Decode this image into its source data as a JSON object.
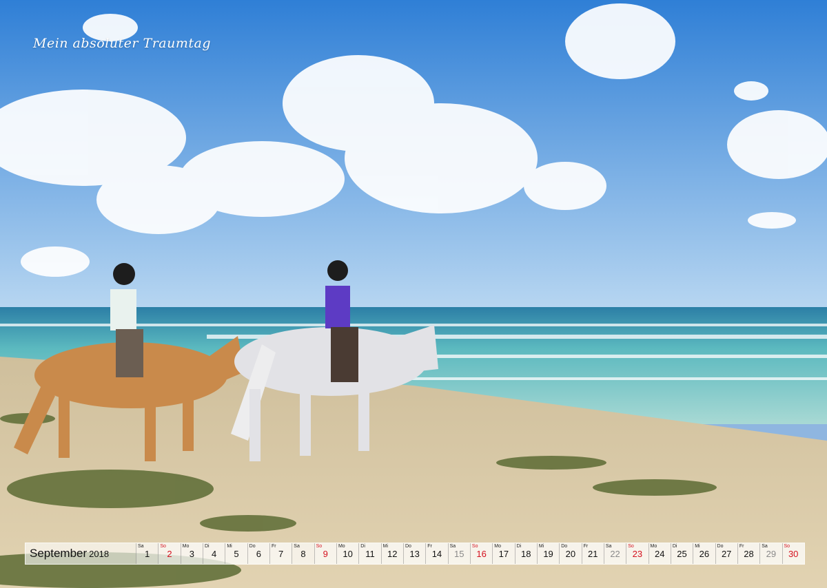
{
  "caption": "Mein absoluter Traumtag",
  "calendar": {
    "month": "September",
    "year": "2018",
    "days": [
      {
        "wd": "Sa",
        "num": "1",
        "type": "weekend"
      },
      {
        "wd": "So",
        "num": "2",
        "type": "sunday"
      },
      {
        "wd": "Mo",
        "num": "3",
        "type": "weekday"
      },
      {
        "wd": "Di",
        "num": "4",
        "type": "weekday"
      },
      {
        "wd": "Mi",
        "num": "5",
        "type": "weekday"
      },
      {
        "wd": "Do",
        "num": "6",
        "type": "weekday"
      },
      {
        "wd": "Fr",
        "num": "7",
        "type": "weekday"
      },
      {
        "wd": "Sa",
        "num": "8",
        "type": "weekend"
      },
      {
        "wd": "So",
        "num": "9",
        "type": "sunday"
      },
      {
        "wd": "Mo",
        "num": "10",
        "type": "weekday"
      },
      {
        "wd": "Di",
        "num": "11",
        "type": "weekday"
      },
      {
        "wd": "Mi",
        "num": "12",
        "type": "weekday"
      },
      {
        "wd": "Do",
        "num": "13",
        "type": "weekday"
      },
      {
        "wd": "Fr",
        "num": "14",
        "type": "weekday"
      },
      {
        "wd": "Sa",
        "num": "15",
        "type": "holiday"
      },
      {
        "wd": "So",
        "num": "16",
        "type": "sunday"
      },
      {
        "wd": "Mo",
        "num": "17",
        "type": "weekday"
      },
      {
        "wd": "Di",
        "num": "18",
        "type": "weekday"
      },
      {
        "wd": "Mi",
        "num": "19",
        "type": "weekday"
      },
      {
        "wd": "Do",
        "num": "20",
        "type": "weekday"
      },
      {
        "wd": "Fr",
        "num": "21",
        "type": "weekday"
      },
      {
        "wd": "Sa",
        "num": "22",
        "type": "holiday"
      },
      {
        "wd": "So",
        "num": "23",
        "type": "sunday"
      },
      {
        "wd": "Mo",
        "num": "24",
        "type": "weekday"
      },
      {
        "wd": "Di",
        "num": "25",
        "type": "weekday"
      },
      {
        "wd": "Mi",
        "num": "26",
        "type": "weekday"
      },
      {
        "wd": "Do",
        "num": "27",
        "type": "weekday"
      },
      {
        "wd": "Fr",
        "num": "28",
        "type": "weekday"
      },
      {
        "wd": "Sa",
        "num": "29",
        "type": "holiday"
      },
      {
        "wd": "So",
        "num": "30",
        "type": "sunday"
      }
    ]
  },
  "colors": {
    "sky_top": "#2f7fd6",
    "sky_bottom": "#a9cdef",
    "sea": "#4fb0b8",
    "sand": "#d9c8a6",
    "sunday": "#d4101e"
  }
}
